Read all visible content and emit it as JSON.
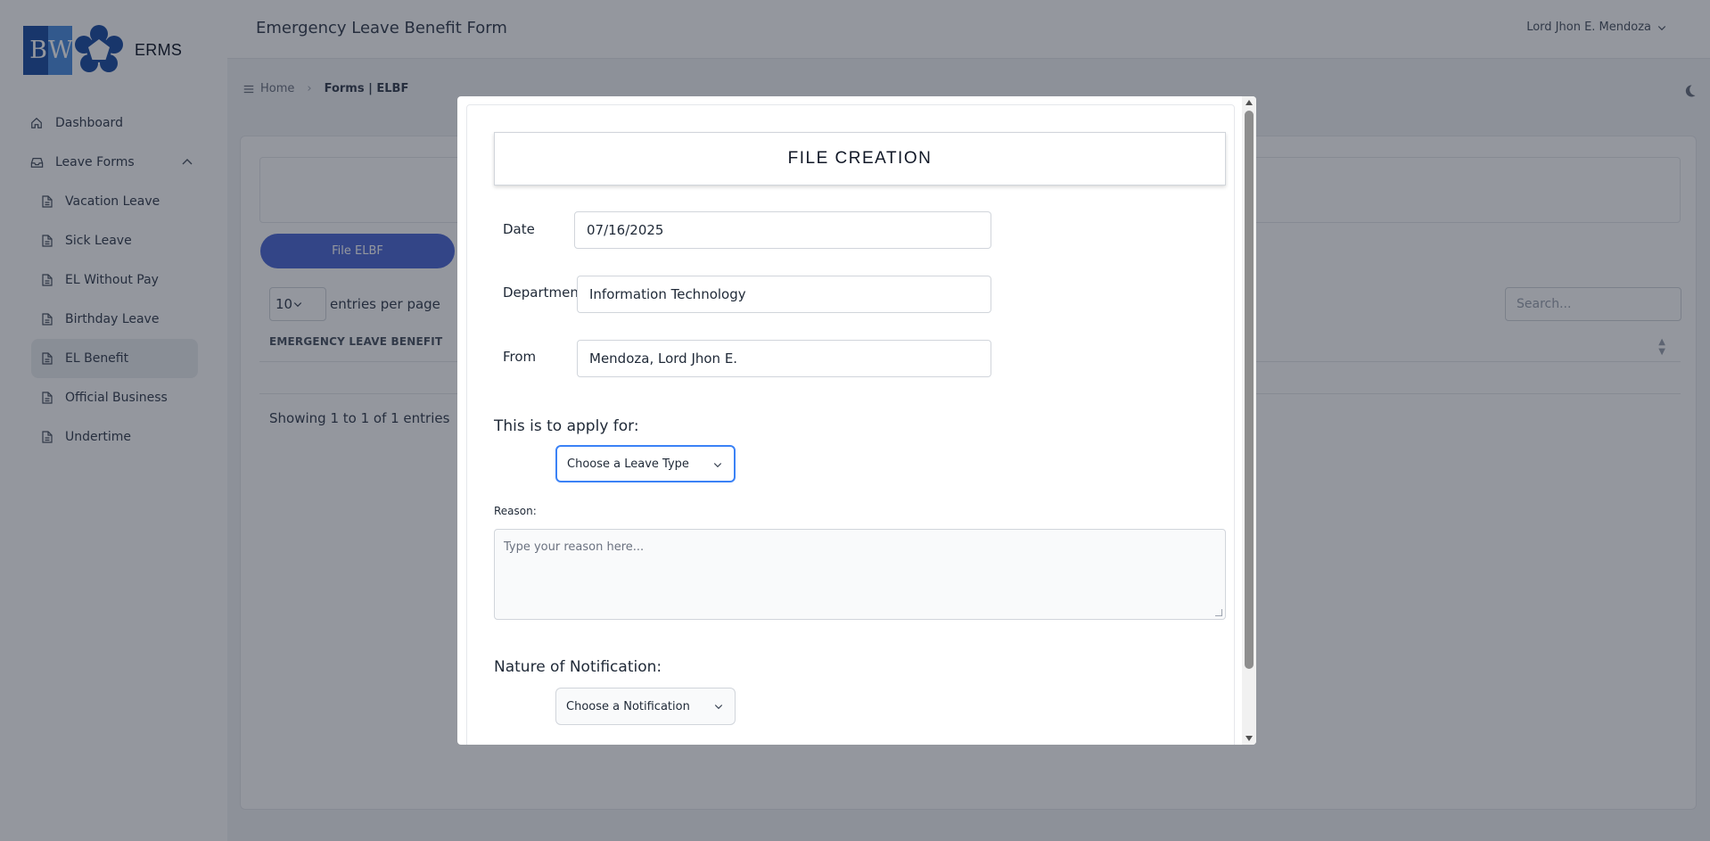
{
  "app": {
    "name": "ERMS",
    "logo_letters": "BW"
  },
  "sidebar": {
    "items": [
      {
        "label": "Dashboard",
        "icon": "home-icon"
      },
      {
        "label": "Leave Forms",
        "icon": "tray-icon",
        "expanded": true
      }
    ],
    "subitems": [
      {
        "label": "Vacation Leave",
        "icon": "document-icon"
      },
      {
        "label": "Sick Leave",
        "icon": "document-icon"
      },
      {
        "label": "EL Without Pay",
        "icon": "document-icon"
      },
      {
        "label": "Birthday Leave",
        "icon": "document-icon"
      },
      {
        "label": "EL Benefit",
        "icon": "document-icon",
        "active": true
      },
      {
        "label": "Official Business",
        "icon": "document-icon"
      },
      {
        "label": "Undertime",
        "icon": "document-icon"
      }
    ]
  },
  "header": {
    "title": "Emergency Leave Benefit Form",
    "user": "Lord Jhon E. Mendoza"
  },
  "breadcrumb": {
    "home": "Home",
    "current": "Forms | ELBF"
  },
  "page": {
    "file_button": "File ELBF",
    "entries_value": "10",
    "entries_label": "entries per page",
    "search_placeholder": "Search...",
    "column_header": "EMERGENCY LEAVE BENEFIT",
    "showing": "Showing 1 to 1 of 1 entries"
  },
  "modal": {
    "title": "FILE CREATION",
    "date_label": "Date",
    "date_value": "07/16/2025",
    "department_label": "Department",
    "department_value": "Information Technology",
    "from_label": "From",
    "from_value": "Mendoza, Lord Jhon E.",
    "apply_label": "This is to apply for:",
    "leave_type_selected": "Choose a Leave Type",
    "reason_label": "Reason:",
    "reason_placeholder": "Type your reason here...",
    "notification_label": "Nature of Notification:",
    "notification_selected": "Choose a Notification"
  },
  "colors": {
    "accent": "#4f6bd6",
    "cancel": "#c4161c",
    "submit": "#1d4ed8",
    "logo_dark": "#1e4fa3",
    "logo_light": "#4e8fe0"
  }
}
